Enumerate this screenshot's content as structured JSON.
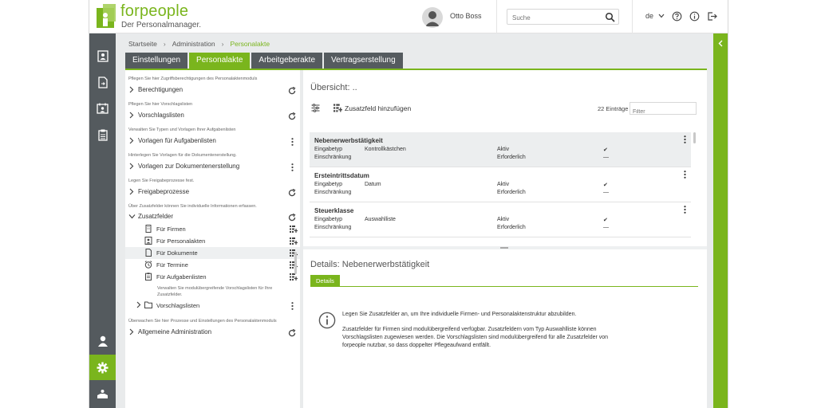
{
  "app": {
    "logo_text": "forpeople",
    "logo_subtitle": "Der Personalmanager."
  },
  "header": {
    "user_name": "Otto Boss",
    "search_placeholder": "Suche",
    "language": "de"
  },
  "breadcrumb": [
    "Startseite",
    "Administration",
    "Personalakte"
  ],
  "tabs": [
    {
      "label": "Einstellungen",
      "active": false
    },
    {
      "label": "Personalakte",
      "active": true
    },
    {
      "label": "Arbeitgeberakte",
      "active": false
    },
    {
      "label": "Vertragserstellung",
      "active": false
    }
  ],
  "sections": [
    {
      "desc": "Pflegen Sie hier Zugriffsberechtigungen des Personalaktenmoduls",
      "title": "Berechtigungen",
      "action": "refresh"
    },
    {
      "desc": "Pflegen Sie hier Vorschlagslisten",
      "title": "Vorschlagslisten",
      "action": "refresh"
    },
    {
      "desc": "Verwalten Sie Typen und Vorlagen Ihrer Aufgabenlisten",
      "title": "Vorlagen für Aufgabenlisten",
      "action": "menu"
    },
    {
      "desc": "Hinterlegen Sie Vorlagen für die Dokumentenerstellung.",
      "title": "Vorlagen zur Dokumentenerstellung",
      "action": "menu"
    },
    {
      "desc": "Legen Sie Freigabeprozesse fest.",
      "title": "Freigabeprozesse",
      "action": "refresh"
    },
    {
      "desc": "Über Zusatzfelder können Sie individuelle Informationen erfassen.",
      "title": "Zusatzfelder",
      "action": "refresh"
    }
  ],
  "zusatzfelder_items": [
    {
      "label": "Für Firmen",
      "icon": "building-icon"
    },
    {
      "label": "Für Personalakten",
      "icon": "personnel-file-icon"
    },
    {
      "label": "Für Dokumente",
      "icon": "document-icon",
      "selected": true
    },
    {
      "label": "Für Termine",
      "icon": "alarm-clock-icon"
    },
    {
      "label": "Für Aufgabenlisten",
      "icon": "clipboard-icon"
    }
  ],
  "vorschlagslisten_sub": {
    "desc_line1": "Verwalten Sie modulübergreifende Vorschlagslisten für Ihre",
    "desc_line2": "Zusatzfelder.",
    "title": "Vorschlagslisten"
  },
  "general_admin": {
    "desc": "Überwachen Sie hier Prozesse und Einstellungen des Personalaktenmoduls",
    "title": "Allgemeine Administration"
  },
  "overview": {
    "title": "Übersicht: ..",
    "add_field_label": "Zusatzfeld hinzufügen",
    "count": "22 Einträge",
    "filter_placeholder": "Filter",
    "cards": [
      {
        "title": "Nebenerwerbstätigkeit",
        "type_label": "Eingabetyp",
        "type_value": "Kontrollkästchen",
        "restriction_label": "Einschränkung",
        "active_label": "Aktiv",
        "required_label": "Erforderlich",
        "active_mark": "✔",
        "required_mark": "—",
        "selected": true
      },
      {
        "title": "Ersteintrittsdatum",
        "type_label": "Eingabetyp",
        "type_value": "Datum",
        "restriction_label": "Einschränkung",
        "active_label": "Aktiv",
        "required_label": "Erforderlich",
        "active_mark": "✔",
        "required_mark": "—"
      },
      {
        "title": "Steuerklasse",
        "type_label": "Eingabetyp",
        "type_value": "Auswahlliste",
        "restriction_label": "Einschränkung",
        "active_label": "Aktiv",
        "required_label": "Erforderlich",
        "active_mark": "✔",
        "required_mark": "—"
      }
    ]
  },
  "details": {
    "prefix": "Details:",
    "name": "Nebenerwerbstätigkeit",
    "tab_label": "Details",
    "info_p1": "Legen Sie Zusatzfelder an, um Ihre individuelle Firmen- und Personalaktenstruktur abzubilden.",
    "info_p2": "Zusatzfelder für Firmen sind modulübergreifend verfügbar. Zusatzfeldern vom Typ Auswahlliste können Vorschlagslisten zugewiesen werden. Die Vorschlagslisten sind modulübergreifend für alle Zusatzfelder von forpeople nutzbar, so dass doppelter Pflegeaufwand entfällt."
  },
  "colors": {
    "brand_green": "#7ab51d",
    "nav_dark": "#545a5e",
    "tab_dark": "#555b5f"
  }
}
